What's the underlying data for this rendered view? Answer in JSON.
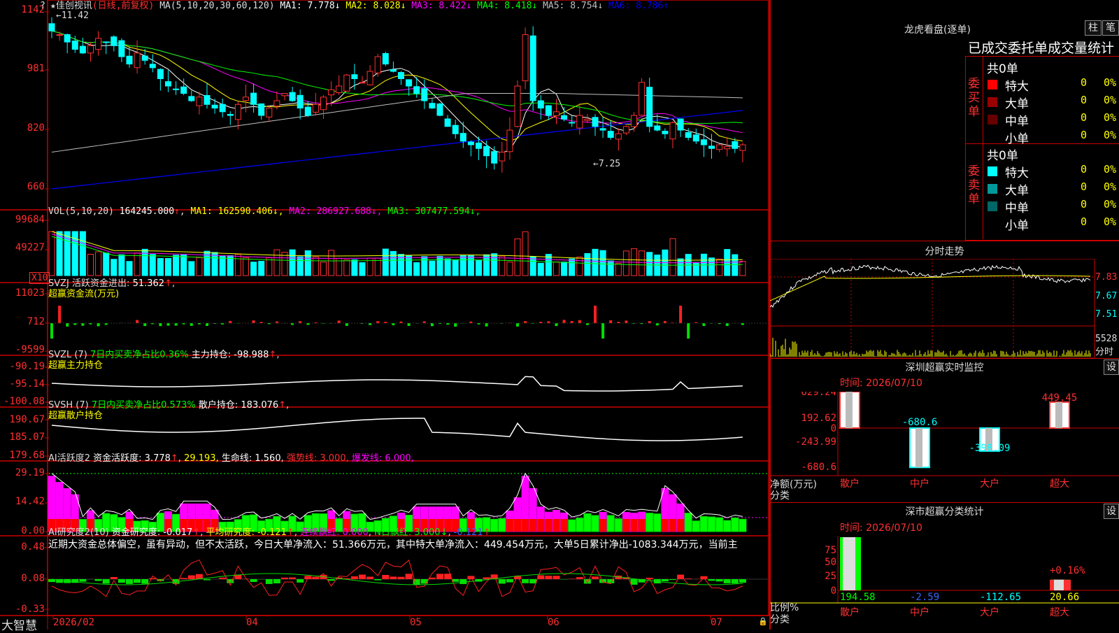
{
  "stock": {
    "name": "佳创视讯",
    "period": "日线",
    "adjust": "前复权",
    "title_star": "★",
    "corner_mark": "?"
  },
  "main_chart": {
    "ma_label": "MA(5,10,20,30,60,120)",
    "ma": [
      {
        "label": "MA1",
        "value": "7.778",
        "arrow": "↓",
        "color": "#ffffff"
      },
      {
        "label": "MA2",
        "value": "8.028",
        "arrow": "↓",
        "color": "#ffff00"
      },
      {
        "label": "MA3",
        "value": "8.422",
        "arrow": "↓",
        "color": "#ff00ff"
      },
      {
        "label": "MA4",
        "value": "8.418",
        "arrow": "↓",
        "color": "#00ff00"
      },
      {
        "label": "MA5",
        "value": "8.754",
        "arrow": "↓",
        "color": "#c0c0c0"
      },
      {
        "label": "MA6",
        "value": "8.786",
        "arrow": "↑",
        "color": "#0000ff"
      }
    ],
    "high_mark": "11.42",
    "low_mark": "7.25",
    "y_ticks": [
      "1142",
      "981",
      "820",
      "660"
    ]
  },
  "chart_data": [
    {
      "type": "candlestick",
      "title": "佳创视讯(日线,前复权)",
      "y_ticks": [
        11.42,
        9.81,
        8.2,
        6.6
      ],
      "ylim": [
        6.5,
        11.6
      ],
      "high": 11.42,
      "low": 7.25,
      "x_labels": [
        "2026/02",
        "04",
        "05",
        "06",
        "07"
      ],
      "series": [
        {
          "name": "MA1",
          "last": 7.778
        },
        {
          "name": "MA2",
          "last": 8.028
        },
        {
          "name": "MA3",
          "last": 8.422
        },
        {
          "name": "MA4",
          "last": 8.418
        },
        {
          "name": "MA5",
          "last": 8.754
        },
        {
          "name": "MA6",
          "last": 8.786
        }
      ]
    },
    {
      "type": "bar",
      "title": "VOL(5,10,20)",
      "value": 164245.0,
      "ylim": [
        0,
        99684
      ],
      "y_ticks": [
        99684,
        49227
      ],
      "multiplier": "X10",
      "series": [
        {
          "name": "MA1",
          "last": 162590.406
        },
        {
          "name": "MA2",
          "last": 286927.688
        },
        {
          "name": "MA3",
          "last": 307477.594
        }
      ]
    },
    {
      "type": "bar",
      "title": "SVZJ",
      "y_ticks": [
        11023,
        712,
        -9599
      ],
      "series": [
        {
          "name": "活跃资金进出",
          "last": 51.362
        }
      ]
    },
    {
      "type": "line",
      "title": "SVZL (7)",
      "y_ticks": [
        -90.19,
        -95.14,
        -100.08
      ],
      "series": [
        {
          "name": "主力持仓",
          "last": -98.988
        }
      ]
    },
    {
      "type": "line",
      "title": "SVSH (7)",
      "y_ticks": [
        190.67,
        185.07,
        179.68
      ],
      "series": [
        {
          "name": "散户持仓",
          "last": 183.076
        }
      ]
    },
    {
      "type": "bar",
      "title": "AI活跃度2",
      "y_ticks": [
        29.19,
        14.42,
        0.0
      ],
      "series": [
        {
          "name": "资金活跃度",
          "last": 3.778
        },
        {
          "name": "生命线",
          "last": 1.56
        },
        {
          "name": "强势线",
          "last": 3.0
        },
        {
          "name": "爆发线",
          "last": 6.0
        }
      ]
    },
    {
      "type": "bar",
      "title": "AI研究度2(10)",
      "y_ticks": [
        0.48,
        0.08,
        -0.33
      ],
      "series": [
        {
          "name": "资金研究度",
          "last": -0.017
        },
        {
          "name": "平均研究度",
          "last": -0.121
        },
        {
          "name": "连续飘红",
          "last": 0.0
        },
        {
          "name": "N日飘红",
          "last": 3.0
        }
      ]
    },
    {
      "type": "bar",
      "title": "深圳超赢实时监控",
      "categories": [
        "散户",
        "中户",
        "大户",
        "超大"
      ],
      "values": [
        629.24,
        -680.6,
        -398.09,
        449.45
      ],
      "ylim": [
        -680.6,
        629.24
      ],
      "y_ticks": [
        629.24,
        192.62,
        0,
        -243.99,
        -680.6
      ],
      "ylabel": "净额(万元)",
      "xlabel": "分类"
    },
    {
      "type": "bar",
      "title": "深市超赢分类统计",
      "categories": [
        "散户",
        "中户",
        "大户",
        "超大"
      ],
      "values": [
        194.58,
        -2.59,
        -112.65,
        20.66
      ],
      "bar_percent": [
        100,
        0,
        0,
        20
      ],
      "annotation": "+0.16%",
      "y_ticks": [
        75,
        50,
        25,
        0
      ],
      "ylabel": "比例%",
      "xlabel": "分类"
    },
    {
      "type": "line",
      "title": "分时走势",
      "y_ticks": [
        7.83,
        7.67,
        7.51
      ],
      "volume_label": "5528"
    }
  ],
  "vol_panel": {
    "name": "VOL(5,10,20)",
    "value": "164245.000",
    "ma": [
      {
        "label": "MA1",
        "value": "162590.406",
        "color": "#ffff00"
      },
      {
        "label": "MA2",
        "value": "286927.688",
        "color": "#ff00ff"
      },
      {
        "label": "MA3",
        "value": "307477.594",
        "color": "#00ff00"
      }
    ],
    "y_ticks": [
      "99684",
      "49227"
    ],
    "multiplier": "X10"
  },
  "svzj_panel": {
    "name": "SVZJ",
    "item": "活跃资金进出:",
    "value": "51.362",
    "sub": "超赢资金流(万元)",
    "y_ticks": [
      "11023",
      "712",
      "-9599"
    ]
  },
  "svzl_panel": {
    "name": "SVZL (7)",
    "ratio_label": "7日内买卖净占比",
    "ratio": "0.36%",
    "item": "主力持仓:",
    "value": "-98.988",
    "sub": "超赢主力持仓",
    "y_ticks": [
      "-90.19",
      "-95.14",
      "-100.08"
    ]
  },
  "svsh_panel": {
    "name": "SVSH (7)",
    "ratio_label": "7日内买卖净占比",
    "ratio": "0.573%",
    "item": "散户持仓:",
    "value": "183.076",
    "sub": "超赢散户持仓",
    "y_ticks": [
      "190.67",
      "185.07",
      "179.68"
    ]
  },
  "ai_act_panel": {
    "name": "AI活跃度2",
    "item1": "资金活跃度:",
    "v1": "3.778",
    "v2": "29.193",
    "item3": "生命线:",
    "v3": "1.560",
    "item4": "强势线:",
    "v4": "3.000",
    "item5": "爆发线:",
    "v5": "6.000",
    "y_ticks": [
      "29.19",
      "14.42",
      "0.00"
    ]
  },
  "ai_res_panel": {
    "name": "AI研究度2(10)",
    "item1": "资金研究度:",
    "v1": "-0.017",
    "item2": "平均研究度:",
    "v2": "-0.121",
    "item3": "连续飘红:",
    "v3": "0.000",
    "item4": "N日飘红:",
    "v4": "3.000",
    "v5": "-0.121",
    "y_ticks": [
      "0.48",
      "0.08",
      "-0.33"
    ],
    "comment": "近期大资金总体偏空，虽有异动，但不太活跃，今日大单净流入：51.366万元，其中特大单净流入：449.454万元，大单5日累计净出-1083.344万元，当前主"
  },
  "x_axis": {
    "labels": [
      "2026/02",
      "04",
      "05",
      "06",
      "07"
    ]
  },
  "bottom_left": "大智慧",
  "longhu": {
    "title": "龙虎看盘(逐单)",
    "btn_bar": "柱",
    "btn_pen": "笔",
    "header": "已成交委托单成交量统计",
    "buy": {
      "side": "委买单",
      "total": "共0单",
      "rows": [
        {
          "label": "特大",
          "count": "0",
          "pct": "0%",
          "color": "#ff0000"
        },
        {
          "label": "大单",
          "count": "0",
          "pct": "0%",
          "color": "#990000"
        },
        {
          "label": "中单",
          "count": "0",
          "pct": "0%",
          "color": "#660000"
        },
        {
          "label": "小单",
          "count": "0",
          "pct": "0%",
          "color": "#000000"
        }
      ]
    },
    "sell": {
      "side": "委卖单",
      "total": "共0单",
      "rows": [
        {
          "label": "特大",
          "count": "0",
          "pct": "0%",
          "color": "#00ffff"
        },
        {
          "label": "大单",
          "count": "0",
          "pct": "0%",
          "color": "#009999"
        },
        {
          "label": "中单",
          "count": "0",
          "pct": "0%",
          "color": "#006666"
        },
        {
          "label": "小单",
          "count": "0",
          "pct": "0%",
          "color": "#000000"
        }
      ]
    }
  },
  "intraday": {
    "title": "分时走势",
    "y_ticks": [
      "7.83",
      "7.67",
      "7.51"
    ],
    "vol_label": "5528",
    "vol_unit": "分时"
  },
  "monitor": {
    "title": "深圳超赢实时监控",
    "date": "时间: 2026/07/10",
    "btn": "设",
    "ylabel": "净额(万元)",
    "xlabel": "分类",
    "y_ticks": [
      "629.24",
      "192.62",
      "0",
      "-243.99",
      "-680.6"
    ],
    "bars": [
      {
        "cat": "散户",
        "value": "629.24"
      },
      {
        "cat": "中户",
        "value": "-680.6"
      },
      {
        "cat": "大户",
        "value": "-398.09"
      },
      {
        "cat": "超大",
        "value": "449.45"
      }
    ]
  },
  "classify": {
    "title": "深市超赢分类统计",
    "date": "时间: 2026/07/10",
    "btn": "设",
    "ylabel": "比例%",
    "xlabel": "分类",
    "y_ticks": [
      "75",
      "50",
      "25",
      "0"
    ],
    "annotation": "+0.16%",
    "bars": [
      {
        "cat": "散户",
        "value": "194.58"
      },
      {
        "cat": "中户",
        "value": "-2.59"
      },
      {
        "cat": "大户",
        "value": "-112.65"
      },
      {
        "cat": "超大",
        "value": "20.66"
      }
    ]
  }
}
